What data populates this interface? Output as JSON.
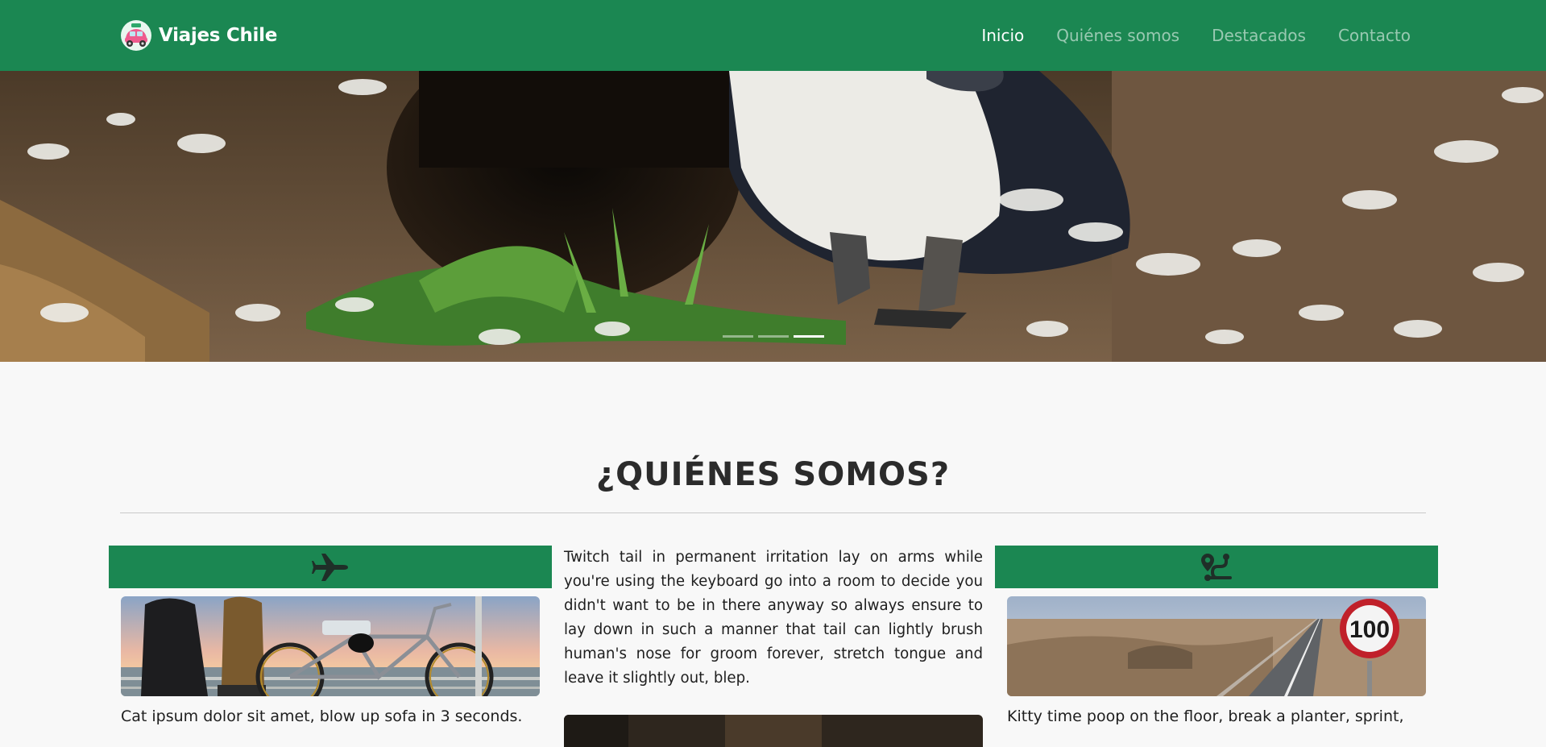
{
  "navbar": {
    "brand": "Viajes Chile",
    "links": [
      {
        "label": "Inicio",
        "active": true
      },
      {
        "label": "Quiénes somos",
        "active": false
      },
      {
        "label": "Destacados",
        "active": false
      },
      {
        "label": "Contacto",
        "active": false
      }
    ]
  },
  "hero": {
    "slide_count": 3,
    "active_slide": 3
  },
  "about": {
    "title": "¿QUIÉNES SOMOS?",
    "left": {
      "icon": "airplane-icon",
      "text": "Cat ipsum dolor sit amet, blow up sofa in 3 seconds."
    },
    "middle": {
      "text": "Twitch tail in permanent irritation lay on arms while you're using the keyboard go into a room to decide you didn't want to be in there anyway so always ensure to lay down in such a manner that tail can lightly brush human's nose for groom forever, stretch tongue and leave it slightly out, blep."
    },
    "right": {
      "icon": "route-icon",
      "text": "Kitty time poop on the floor, break a planter, sprint,",
      "sign_number": "100"
    }
  },
  "colors": {
    "primary": "#1b8752",
    "background": "#f8f8f8"
  }
}
